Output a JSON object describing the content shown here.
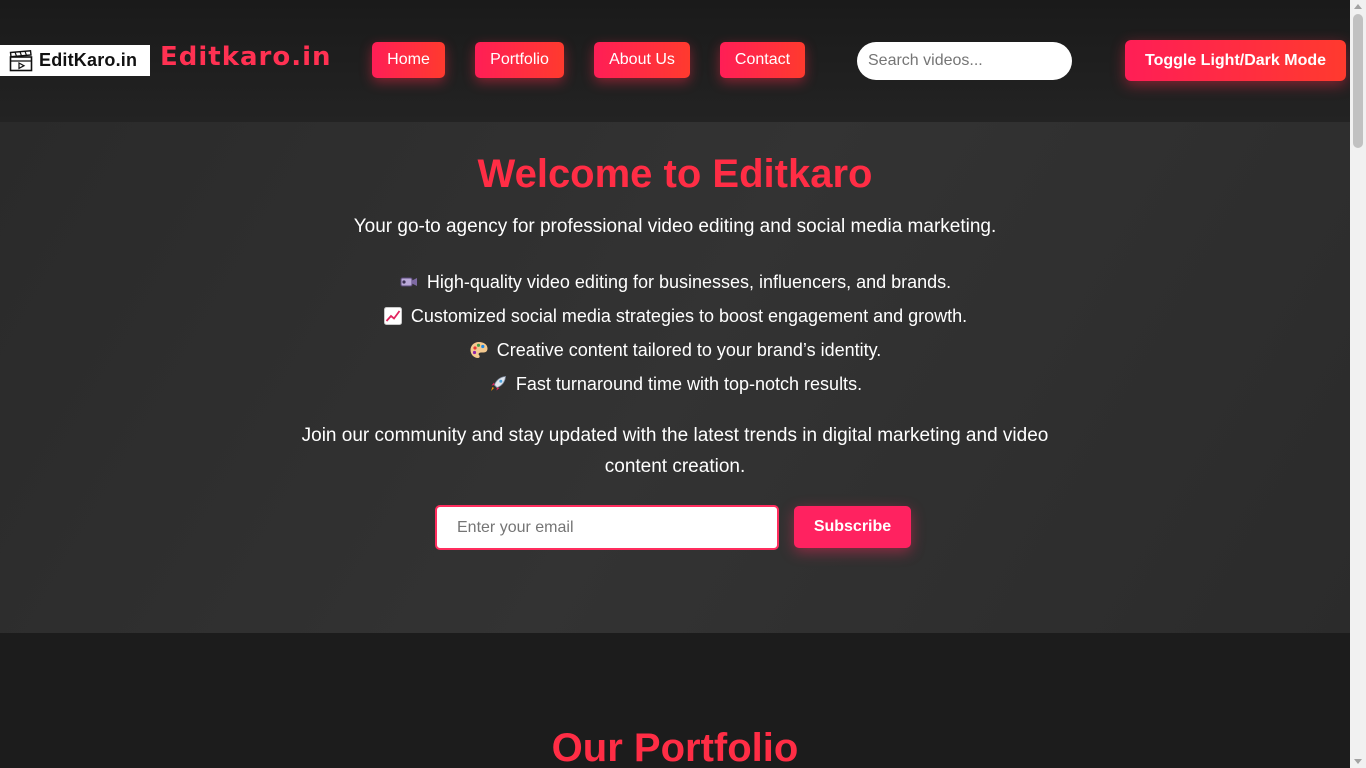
{
  "header": {
    "logo_text": "EditKaro.in",
    "brand": "Editkaro.in",
    "nav": [
      {
        "label": "Home"
      },
      {
        "label": "Portfolio"
      },
      {
        "label": "About Us"
      },
      {
        "label": "Contact"
      }
    ],
    "search_placeholder": "Search videos...",
    "toggle_label": "Toggle Light/Dark Mode"
  },
  "hero": {
    "title": "Welcome to Editkaro",
    "subtitle": "Your go-to agency for professional video editing and social media marketing.",
    "features": [
      {
        "icon": "video-camera-icon",
        "text": "High-quality video editing for businesses, influencers, and brands."
      },
      {
        "icon": "chart-increasing-icon",
        "text": "Customized social media strategies to boost engagement and growth."
      },
      {
        "icon": "artist-palette-icon",
        "text": "Creative content tailored to your brand’s identity."
      },
      {
        "icon": "rocket-icon",
        "text": "Fast turnaround time with top-notch results."
      }
    ],
    "join_text": "Join our community and stay updated with the latest trends in digital marketing and video content creation.",
    "email_placeholder": "Enter your email",
    "subscribe_label": "Subscribe"
  },
  "portfolio": {
    "title": "Our Portfolio"
  },
  "colors": {
    "accent": "#ff2d45",
    "button_gradient_start": "#ff1e56",
    "button_gradient_end": "#ff3a2e",
    "background": "#1c1c1c",
    "hero_background": "#2f2f2f"
  }
}
